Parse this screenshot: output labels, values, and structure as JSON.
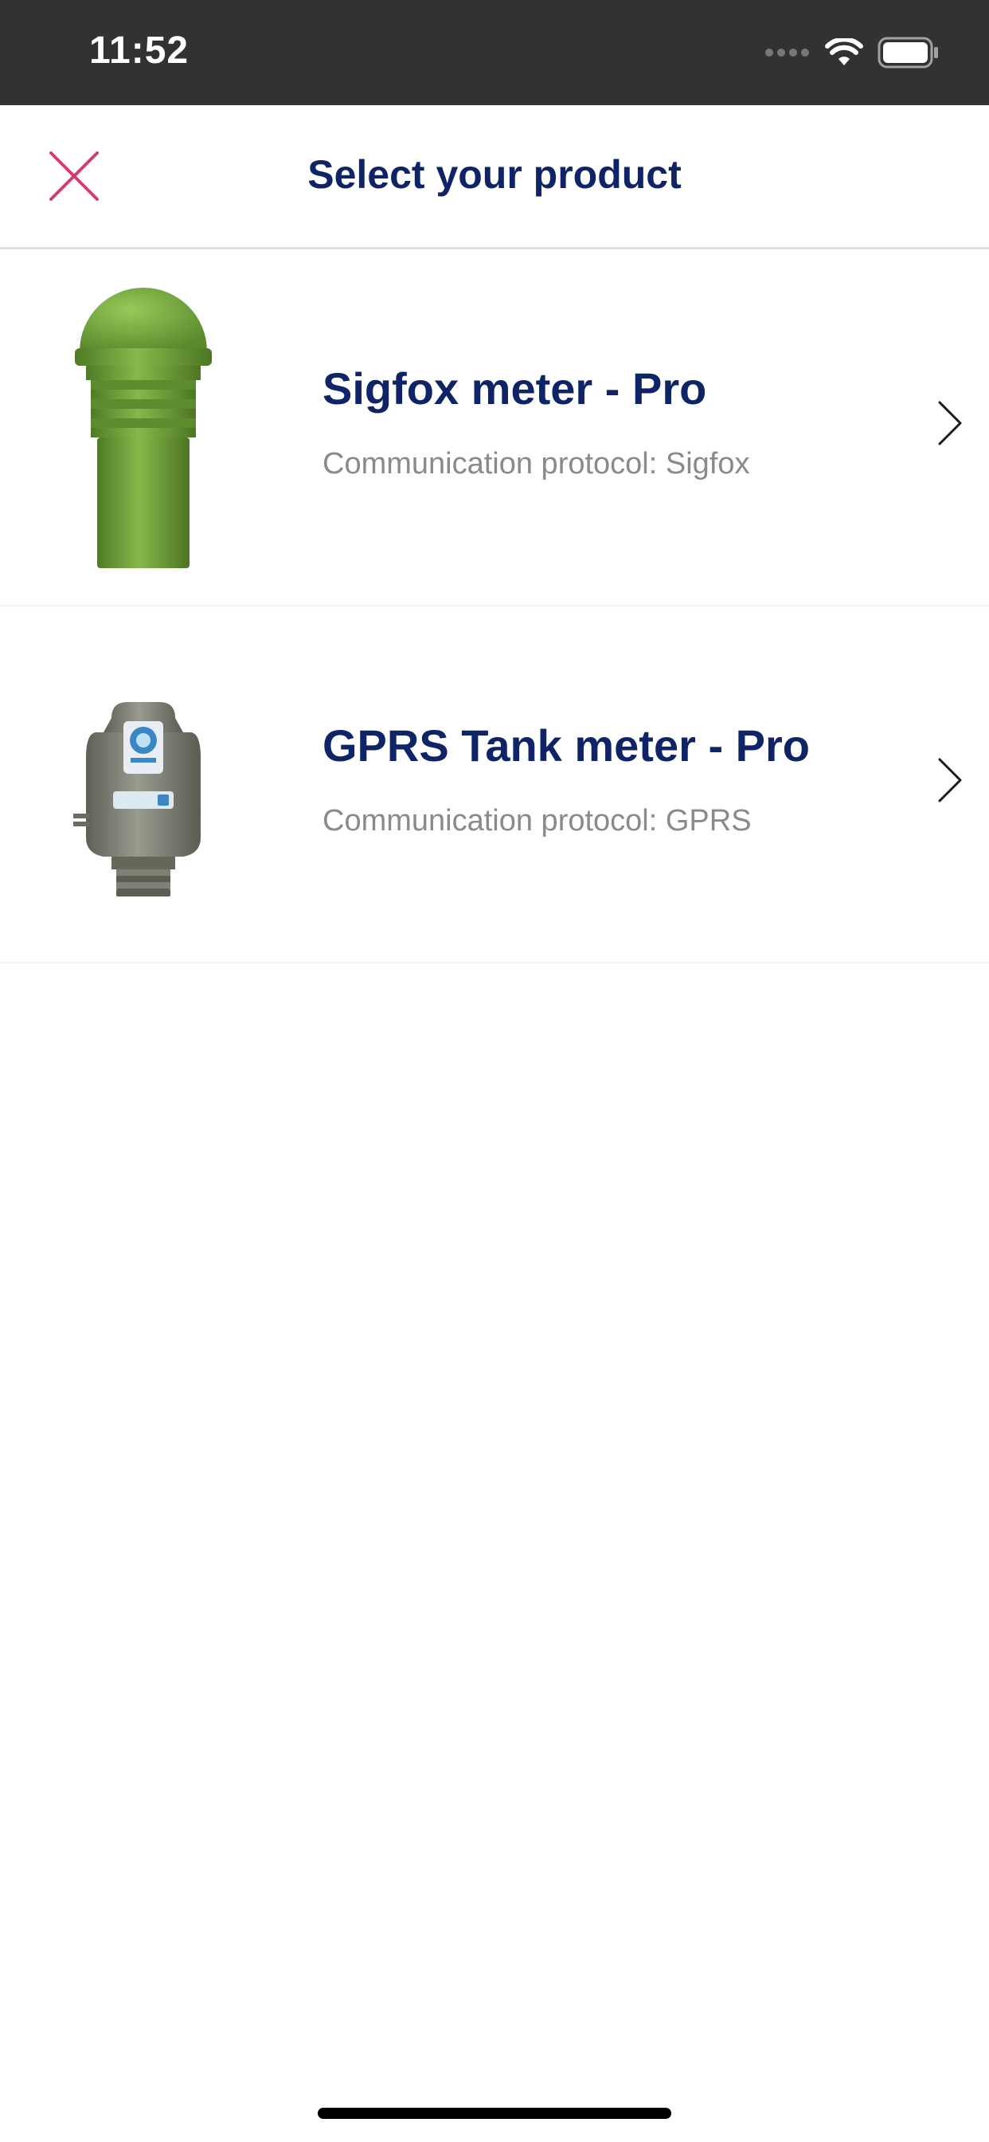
{
  "status_bar": {
    "time": "11:52",
    "icons": [
      "cellular-signal-icon",
      "wifi-icon",
      "battery-icon"
    ]
  },
  "nav": {
    "title": "Select your product",
    "close_icon": "close-icon"
  },
  "products": [
    {
      "title": "Sigfox meter - Pro",
      "subtitle": "Communication protocol: Sigfox",
      "image": "green-dome-sensor",
      "image_color": "#74a33f"
    },
    {
      "title": "GPRS Tank meter - Pro",
      "subtitle": "Communication protocol: GPRS",
      "image": "gray-tank-meter",
      "image_color": "#7d7e72"
    }
  ],
  "colors": {
    "accent": "#d63b6b",
    "title": "#0e2466",
    "subtitle": "#8a8a8a",
    "status_bar_bg": "#323232"
  }
}
